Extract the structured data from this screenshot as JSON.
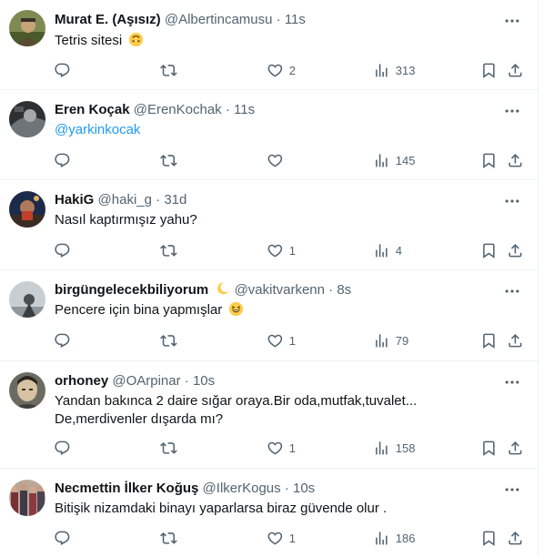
{
  "tweets": [
    {
      "name": "Murat E. (Aşısız)",
      "handle": "@Albertincamusu",
      "dot": "·",
      "time": "11s",
      "text": "Tetris sitesi",
      "emoji": "upside-down-face-emoji",
      "replies": "",
      "retweets": "",
      "likes": "2",
      "views": "313"
    },
    {
      "name": "Eren Koçak",
      "handle": "@ErenKochak",
      "dot": "·",
      "time": "11s",
      "mention": "@yarkinkocak",
      "replies": "",
      "retweets": "",
      "likes": "",
      "views": "145"
    },
    {
      "name": "HakiG",
      "handle": "@haki_g",
      "dot": "·",
      "time": "31d",
      "text": "Nasıl kaptırmışız yahu?",
      "replies": "",
      "retweets": "",
      "likes": "1",
      "views": "4"
    },
    {
      "name": "birgüngelecekbiliyorum",
      "name_emoji": "crescent-moon-emoji",
      "handle": "@vakitvarkenn",
      "dot": "·",
      "time": "8s",
      "text": "Pencere için bina yapmışlar",
      "emoji": "grinning-squinting-face-emoji",
      "replies": "",
      "retweets": "",
      "likes": "1",
      "views": "79"
    },
    {
      "name": "orhoney",
      "handle": "@OArpinar",
      "dot": "·",
      "time": "10s",
      "text_line1": "Yandan bakınca 2 daire sığar oraya.Bir oda,mutfak,tuvalet...",
      "text_line2": "De,merdivenler dışarda mı?",
      "replies": "",
      "retweets": "",
      "likes": "1",
      "views": "158"
    },
    {
      "name": "Necmettin İlker Koğuş",
      "handle": "@IlkerKogus",
      "dot": "·",
      "time": "10s",
      "text": "Bitişik nizamdaki binayı yaparlarsa biraz güvende olur .",
      "replies": "",
      "retweets": "",
      "likes": "1",
      "views": "186"
    }
  ],
  "colors": {
    "text": "#0f1419",
    "secondary": "#536471",
    "link": "#1d9bf0",
    "divider": "#eff3f4"
  }
}
